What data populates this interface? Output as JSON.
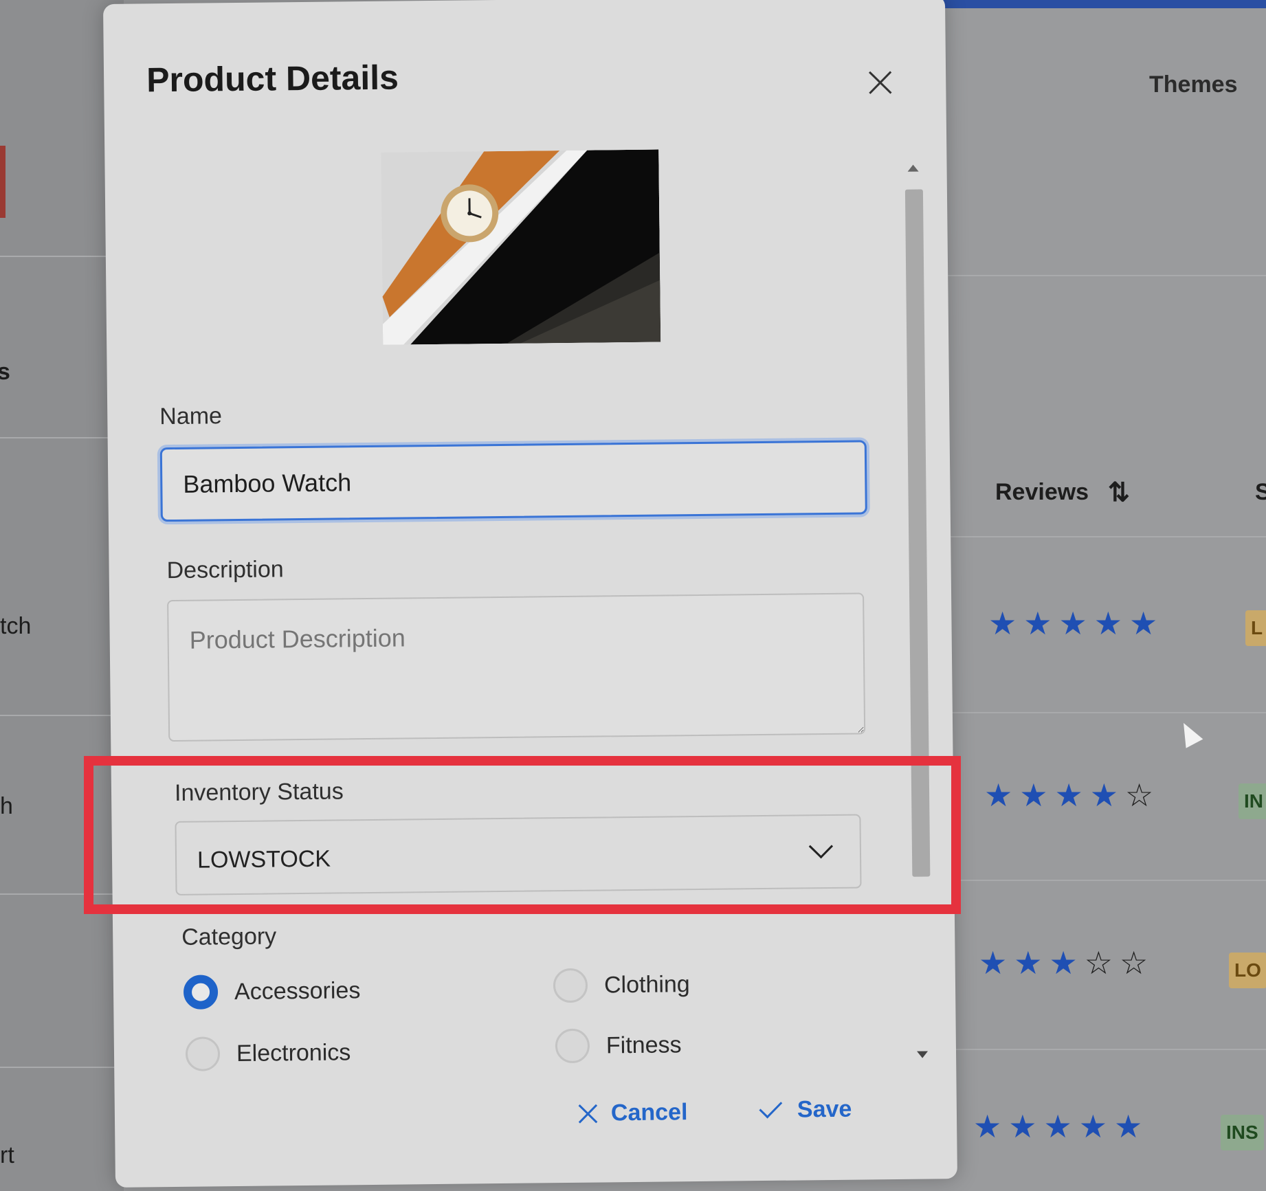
{
  "background": {
    "themes_label": "Themes",
    "reviews_header": "Reviews",
    "sort_icon": "sort-arrows-icon",
    "column_s_fragment": "S",
    "left_fragments": [
      "s",
      "tch",
      "h",
      "rt"
    ],
    "ratings": [
      {
        "stars": 5,
        "badge": "L"
      },
      {
        "stars": 4,
        "badge": "IN"
      },
      {
        "stars": 3,
        "badge": "LO"
      },
      {
        "stars": 5,
        "badge": "INS"
      }
    ],
    "colors": {
      "star": "#1f4fb3",
      "accent_bar": "#2a4fa3"
    }
  },
  "dialog": {
    "title": "Product Details",
    "close_icon": "close-icon",
    "image_alt": "bamboo watch product image",
    "name_label": "Name",
    "name_value": "Bamboo Watch",
    "description_label": "Description",
    "description_placeholder": "Product Description",
    "inventory_label": "Inventory Status",
    "inventory_value": "LOWSTOCK",
    "category_label": "Category",
    "categories": [
      {
        "label": "Accessories",
        "checked": true
      },
      {
        "label": "Clothing",
        "checked": false
      },
      {
        "label": "Electronics",
        "checked": false
      },
      {
        "label": "Fitness",
        "checked": false
      }
    ],
    "cancel_label": "Cancel",
    "save_label": "Save",
    "colors": {
      "primary": "#2466c9",
      "highlight_box": "#e5323e"
    }
  }
}
